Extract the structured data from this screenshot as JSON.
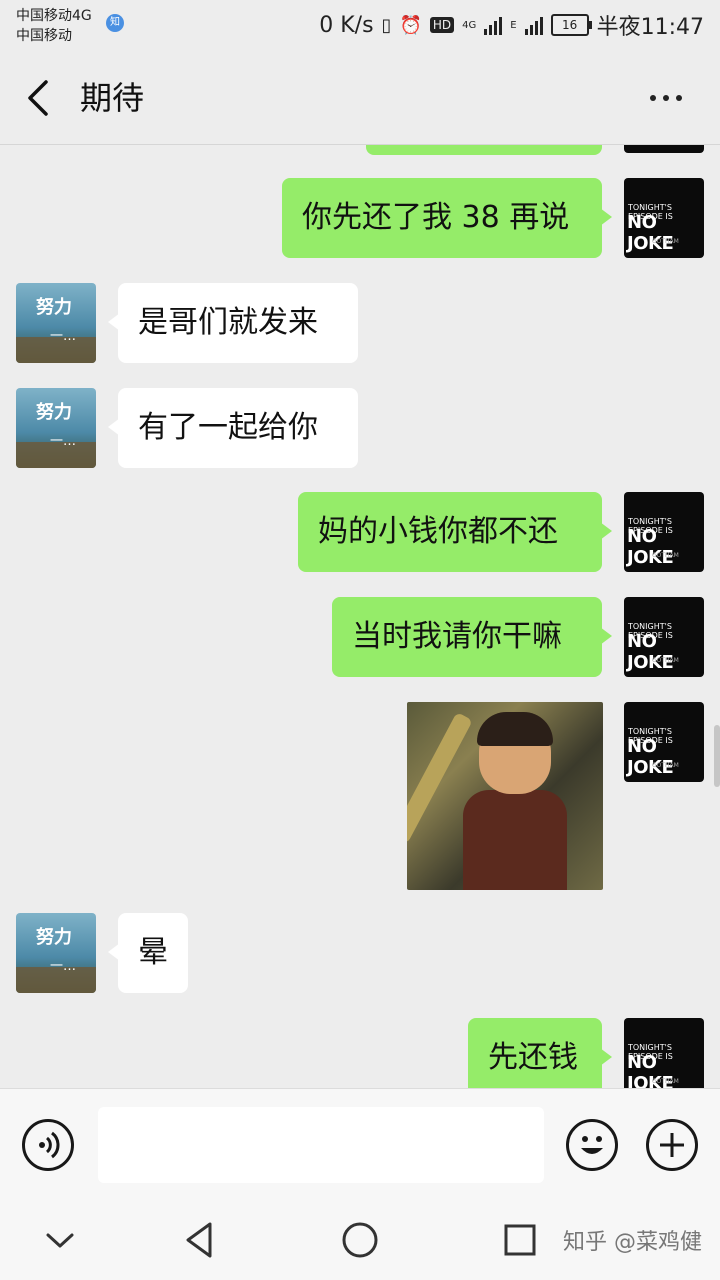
{
  "status_bar": {
    "carrier_line1": "中国移动4G",
    "carrier_line2": "中国移动",
    "app_badge": "知",
    "net_speed": "0 K/s",
    "hd": "HD",
    "signal_label_1": "4G",
    "signal_label_2": "E",
    "battery": "16",
    "time": "半夜11:47"
  },
  "header": {
    "title": "期待"
  },
  "contact_avatar": {
    "text_main": "努力",
    "text_sub": "一…"
  },
  "my_avatar": {
    "line1": "TONIGHT'S EPISODE IS",
    "line2": "NO JOKE",
    "line3": "GOTHAM"
  },
  "messages": [
    {
      "from": "me",
      "text": "你先还了我 38 再说"
    },
    {
      "from": "them",
      "text": "是哥们就发来"
    },
    {
      "from": "them",
      "text": "有了一起给你"
    },
    {
      "from": "me",
      "text": "妈的小钱你都不还"
    },
    {
      "from": "me",
      "text": "当时我请你干嘛"
    },
    {
      "from": "me",
      "type": "image"
    },
    {
      "from": "them",
      "text": "晕"
    },
    {
      "from": "me",
      "text": "先还钱"
    }
  ],
  "input_bar": {
    "placeholder": ""
  },
  "watermark": "知乎 @菜鸡健",
  "colors": {
    "my_bubble": "#95ec69",
    "their_bubble": "#ffffff",
    "background": "#ededed"
  }
}
